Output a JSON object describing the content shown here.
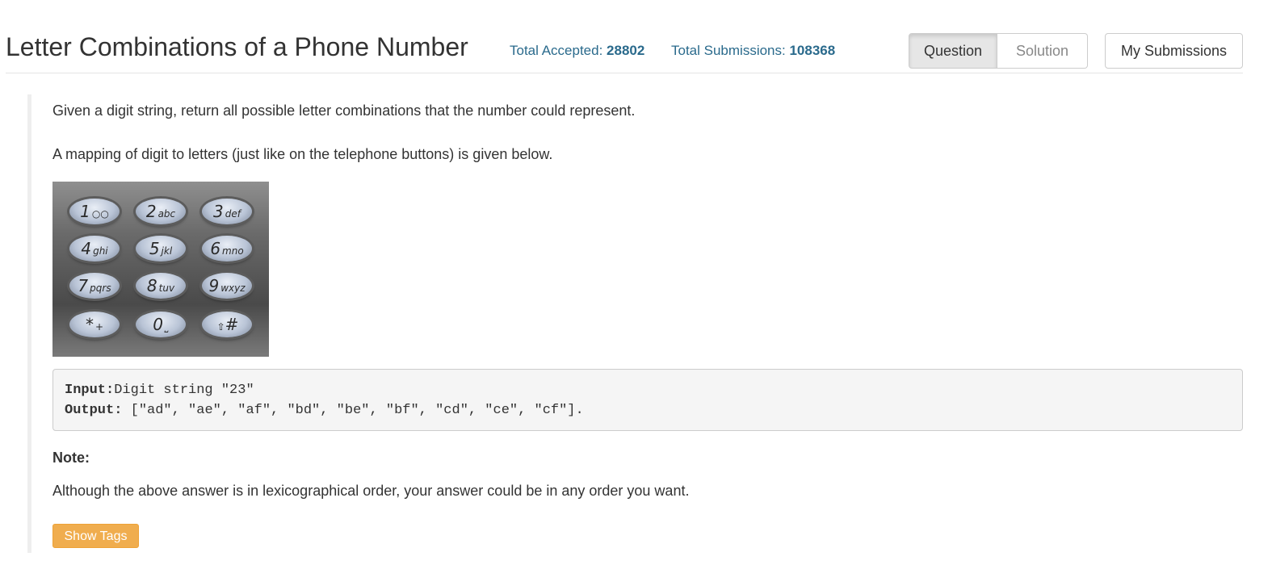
{
  "header": {
    "title": "Letter Combinations of a Phone Number",
    "accepted_label": "Total Accepted:",
    "accepted_value": "28802",
    "submissions_label": "Total Submissions:",
    "submissions_value": "108368"
  },
  "tabs": {
    "question": "Question",
    "solution": "Solution",
    "my_submissions": "My Submissions"
  },
  "description": {
    "para1": "Given a digit string, return all possible letter combinations that the number could represent.",
    "para2": "A mapping of digit to letters (just like on the telephone buttons) is given below."
  },
  "keypad": {
    "keys": [
      {
        "digit": "1",
        "letters": "○○"
      },
      {
        "digit": "2",
        "letters": "abc"
      },
      {
        "digit": "3",
        "letters": "def"
      },
      {
        "digit": "4",
        "letters": "ghi"
      },
      {
        "digit": "5",
        "letters": "jkl"
      },
      {
        "digit": "6",
        "letters": "mno"
      },
      {
        "digit": "7",
        "letters": "pqrs"
      },
      {
        "digit": "8",
        "letters": "tuv"
      },
      {
        "digit": "9",
        "letters": "wxyz"
      },
      {
        "digit": "*",
        "letters": "+"
      },
      {
        "digit": "0",
        "letters": "⎵"
      },
      {
        "digit": "#",
        "letters": "⇧"
      }
    ]
  },
  "example": {
    "input_label": "Input:",
    "input_value": "Digit string \"23\"",
    "output_label": "Output:",
    "output_value": " [\"ad\", \"ae\", \"af\", \"bd\", \"be\", \"bf\", \"cd\", \"ce\", \"cf\"]."
  },
  "note": {
    "heading": "Note:",
    "text": "Although the above answer is in lexicographical order, your answer could be in any order you want."
  },
  "show_tags_label": "Show Tags"
}
